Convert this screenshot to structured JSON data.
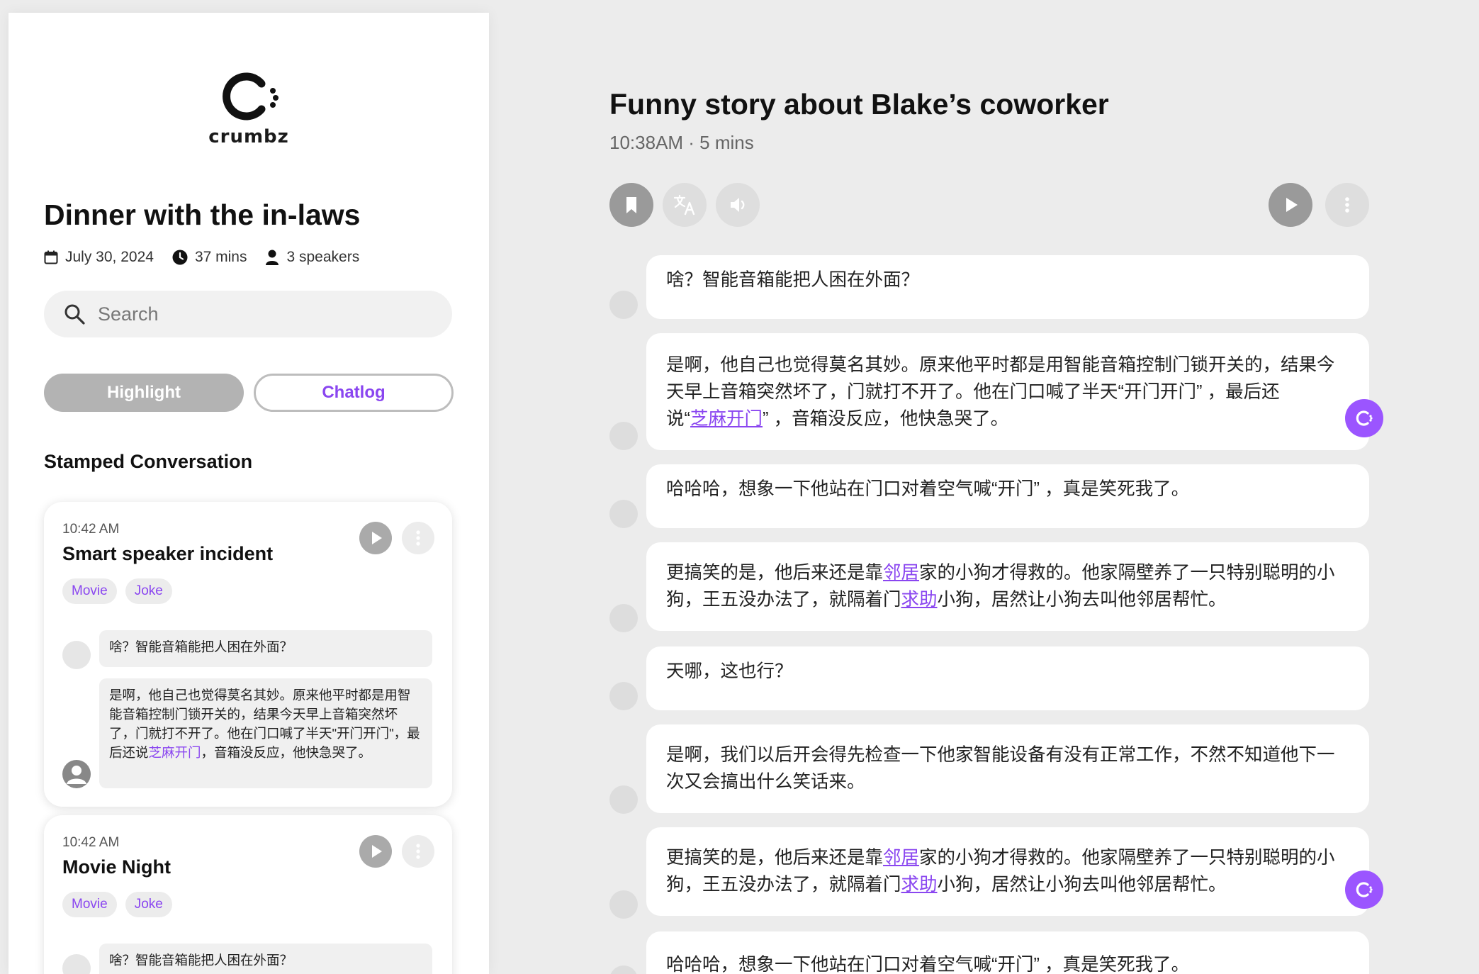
{
  "brand": {
    "name": "crumbz",
    "accent": "#8a46f0"
  },
  "left": {
    "title": "Dinner with the in-laws",
    "meta": {
      "date": "July 30, 2024",
      "duration": "37 mins",
      "speakers": "3 speakers"
    },
    "search": {
      "placeholder": "Search"
    },
    "buttons": {
      "highlight": "Highlight",
      "chatlog": "Chatlog"
    },
    "section_title": "Stamped Conversation",
    "cards": [
      {
        "time": "10:42 AM",
        "title": "Smart speaker incident",
        "tags": [
          "Movie",
          "Joke"
        ],
        "line1": "啥？智能音箱能把人困在外面？",
        "line2_pre": "是啊，他自己也觉得莫名其妙。原来他平时都是用智能音箱控制门锁开关的，结果今天早上音箱突然坏了，门就打不开了。他在门口喊了半天\"开门开门\"，最后还说",
        "line2_link": "芝麻开门",
        "line2_post": "，音箱没反应，他快急哭了。"
      },
      {
        "time": "10:42 AM",
        "title": "Movie Night",
        "tags": [
          "Movie",
          "Joke"
        ],
        "line1": "啥？智能音箱能把人困在外面？"
      }
    ]
  },
  "main": {
    "title": "Funny story about Blake’s coworker",
    "subtitle": "10:38AM · 5 mins",
    "toolbar": [
      "bookmark-icon",
      "translate-icon",
      "volume-icon",
      "play-icon",
      "more-icon"
    ],
    "messages": {
      "m1": "啥？智能音箱能把人困在外面？",
      "m2a": "是啊，他自己也觉得莫名其妙。原来他平时都是用智能音箱控制门锁开关的，结果今",
      "m2b": "天早上音箱突然坏了，门就打不开了。他在门口喊了半天“开门开门” ，最后还",
      "m2c_pre": "说“",
      "m2c_link": "芝麻开门",
      "m2c_post": "” ，音箱没反应，他快急哭了。",
      "m3": "哈哈哈，想象一下他站在门口对着空气喊“开门” ，真是笑死我了。",
      "m4a_pre": "更搞笑的是，他后来还是靠",
      "m4a_link": "邻居",
      "m4a_post": "家的小狗才得救的。他家隔壁养了一只特别聪明的小",
      "m4b_pre": "狗，王五没办法了，就隔着门",
      "m4b_link": "求助",
      "m4b_post": "小狗，居然让小狗去叫他邻居帮忙。",
      "m5": "天哪，这也行？",
      "m6a": "是啊，我们以后开会得先检查一下他家智能设备有没有正常工作，不然不知道他下一",
      "m6b": "次又会搞出什么笑话来。",
      "m7a_pre": "更搞笑的是，他后来还是靠",
      "m7a_link": "邻居",
      "m7a_post": "家的小狗才得救的。他家隔壁养了一只特别聪明的小",
      "m7b_pre": "狗，王五没办法了，就隔着门",
      "m7b_link": "求助",
      "m7b_post": "小狗，居然让小狗去叫他邻居帮忙。",
      "m8": "哈哈哈，想象一下他站在门口对着空气喊“开门” ，真是笑死我了。"
    }
  }
}
